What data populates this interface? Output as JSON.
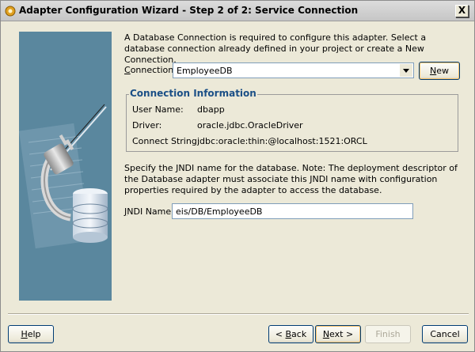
{
  "window": {
    "title": "Adapter Configuration Wizard - Step 2 of 2: Service Connection",
    "close_label": "X"
  },
  "intro_text": "A Database Connection is required to configure this adapter. Select a database connection already defined in your project or create a New Connection.",
  "connection": {
    "label_prefix": "C",
    "label_rest": "onnection:",
    "value": "EmployeeDB",
    "new_button_prefix": "N",
    "new_button_rest": "ew"
  },
  "connection_info": {
    "title": "Connection Information",
    "rows": [
      {
        "label": "User Name:",
        "value": "dbapp"
      },
      {
        "label": "Driver:",
        "value": "oracle.jdbc.OracleDriver"
      },
      {
        "label": "Connect String:",
        "value": "jdbc:oracle:thin:@localhost:1521:ORCL"
      }
    ]
  },
  "jndi": {
    "description": "Specify the JNDI name for the database.  Note: The deployment descriptor of the Database adapter must associate this JNDI name with configuration properties required by the adapter to access the database.",
    "label_prefix": "J",
    "label_rest": "NDI Name:",
    "value": "eis/DB/EmployeeDB"
  },
  "footer": {
    "help_prefix": "H",
    "help_rest": "elp",
    "back_prefix": "< ",
    "back_u": "B",
    "back_rest": "ack",
    "next_u": "N",
    "next_rest": "ext >",
    "finish": "Finish",
    "cancel": "Cancel"
  },
  "colors": {
    "accent": "#1b4f86",
    "focus": "#f7c26a"
  }
}
